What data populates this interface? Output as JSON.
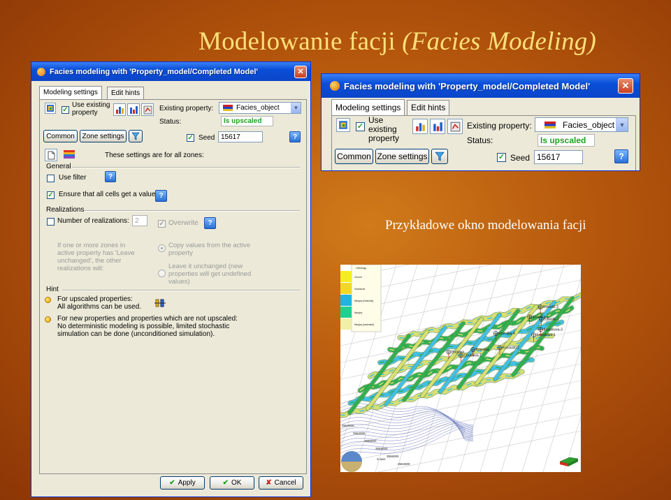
{
  "slide": {
    "title_main": "Modelowanie facji",
    "title_paren": "(Facies Modeling)",
    "caption": "Przykładowe okno modelowania facji"
  },
  "dialog": {
    "title": "Facies modeling with 'Property_model/Completed Model'",
    "close_glyph": "✕",
    "tabs": [
      "Modeling settings",
      "Edit hints"
    ],
    "use_existing_label": "Use existing property",
    "use_existing_checked": true,
    "existing_property_label": "Existing property:",
    "existing_property_value": "Facies_object",
    "status_label": "Status:",
    "status_value": "Is upscaled",
    "common_button": "Common",
    "zone_settings_button": "Zone settings",
    "seed_label": "Seed",
    "seed_checked": true,
    "seed_value": "15617",
    "all_zones_text": "These settings are for all zones:",
    "general_header": "General",
    "use_filter_label": "Use filter",
    "use_filter_checked": false,
    "ensure_label": "Ensure that all cells get a value",
    "ensure_checked": true,
    "realizations_header": "Realizations",
    "num_realizations_label": "Number of realizations:",
    "num_realizations_value": "2",
    "overwrite_label": "Overwrite",
    "info_gray": "If one or more zones in\nactive property has 'Leave\nunchanged', the other\nrealizations will:",
    "radio_copy": "Copy values from the active\nproperty",
    "radio_leave": "Leave it unchanged (new\nproperties will get undefined\nvalues)",
    "hint_header": "Hint",
    "hint1": "For upscaled properties:\nAll algorithms can be used.",
    "hint2": "For new properties and properties which are not upscaled:\nNo deterministic modeling is possible, limited stochastic\nsimulation can be done (unconditioned simulation).",
    "apply_button": "Apply",
    "ok_button": "OK",
    "cancel_button": "Cancel",
    "help_glyph": "?"
  },
  "model_view": {
    "legend_title": "Lithology",
    "legend_items": [
      {
        "label": "Ground",
        "color": "#f4ee20"
      },
      {
        "label": "Sandstone",
        "color": "#f2d826"
      },
      {
        "label": "Mergley (heterolity)",
        "color": "#20b4e0"
      },
      {
        "label": "Mergley",
        "color": "#20d090"
      },
      {
        "label": "Mergley (laminated)",
        "color": "#f0f0a8"
      }
    ],
    "wells": [
      "Kowalki-3",
      "Kowalka-1",
      "Bogowa",
      "Kowalka-4",
      "Kowalki-1",
      "Kowalka",
      "Chobowa-1",
      "Kowalski-1",
      "Kowalowa-3",
      "Kowalowa-1"
    ],
    "y_ticks": [
      "3564000",
      "3562000",
      "3560000",
      "3558000",
      "3556000",
      "3554000"
    ],
    "x_axis_label": "X-axis",
    "colors": {
      "mesh_light": "#d8e070",
      "mesh_cyan": "#40c0e8",
      "mesh_green": "#30b050",
      "contour": "#7080c0"
    }
  }
}
